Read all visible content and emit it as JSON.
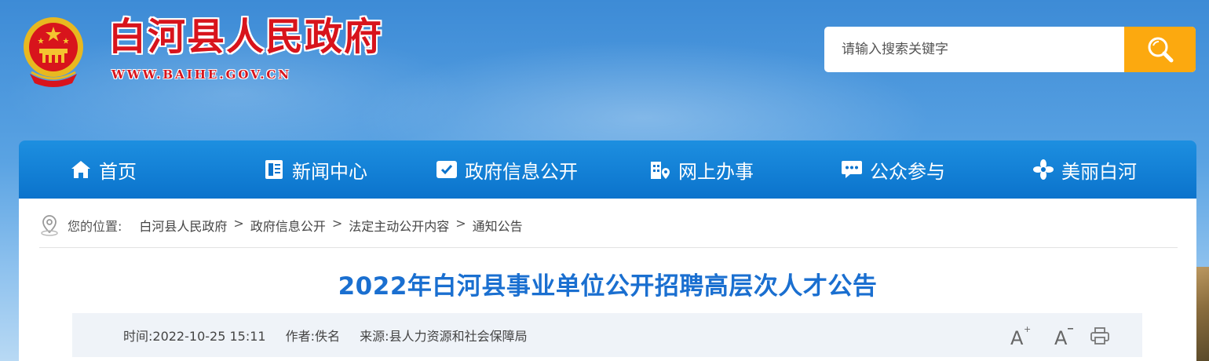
{
  "header": {
    "title": "白河县人民政府",
    "url": "WWW.BAIHE.GOV.CN",
    "emblem_icon": "national-emblem-icon"
  },
  "search": {
    "placeholder": "请输入搜索关键字",
    "button_icon": "search-icon"
  },
  "nav": {
    "items": [
      {
        "label": "首页",
        "icon": "home-icon"
      },
      {
        "label": "新闻中心",
        "icon": "newspaper-icon"
      },
      {
        "label": "政府信息公开",
        "icon": "info-card-icon"
      },
      {
        "label": "网上办事",
        "icon": "building-location-icon"
      },
      {
        "label": "公众参与",
        "icon": "chat-icon"
      },
      {
        "label": "美丽白河",
        "icon": "flower-icon"
      }
    ]
  },
  "breadcrumb": {
    "label": "您的位置:",
    "items": [
      "白河县人民政府",
      "政府信息公开",
      "法定主动公开内容",
      "通知公告"
    ],
    "separator": ">"
  },
  "article": {
    "title": "2022年白河县事业单位公开招聘高层次人才公告",
    "time": "时间:2022-10-25 15:11",
    "author": "作者:佚名",
    "source": "来源:县人力资源和社会保障局"
  },
  "tools": {
    "font_increase": "A",
    "font_decrease": "A",
    "print_icon": "print-icon"
  },
  "colors": {
    "title_red": "#d8141c",
    "nav_blue": "#0b73cc",
    "search_orange": "#fca90f",
    "article_title_blue": "#1a6fd0"
  }
}
